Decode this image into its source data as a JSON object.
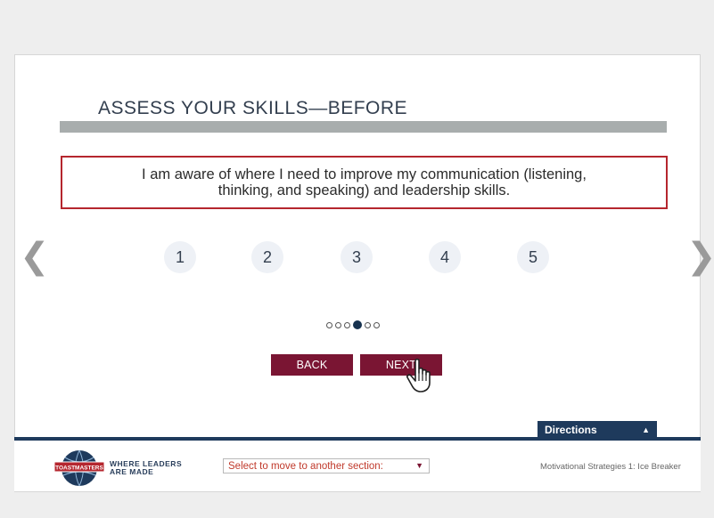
{
  "title": "ASSESS YOUR SKILLS—BEFORE",
  "statement": "I am aware of where I need to improve my communication (listening, thinking, and speaking) and leadership skills.",
  "nav": {
    "prev_glyph": "❮",
    "next_glyph": "❯"
  },
  "ratings": [
    "1",
    "2",
    "3",
    "4",
    "5"
  ],
  "progress": {
    "total": 6,
    "current": 4
  },
  "buttons": {
    "back_label": "BACK",
    "next_label": "NEXT"
  },
  "directions": {
    "label": "Directions",
    "toggle_glyph": "▲"
  },
  "footer": {
    "logo_text": "TOASTMASTERS",
    "tagline_line1": "WHERE LEADERS",
    "tagline_line2": "ARE MADE",
    "section_select_value": "Select to move to another section:",
    "course_label": "Motivational Strategies 1: Ice Breaker"
  },
  "colors": {
    "accent": "#7a1533",
    "navy": "#1e3a5c",
    "statement_border": "#b5262e",
    "title_bar": "#a8adad"
  },
  "icons": {
    "cursor": "hand-pointer-icon",
    "caret": "triangle-down-icon"
  }
}
